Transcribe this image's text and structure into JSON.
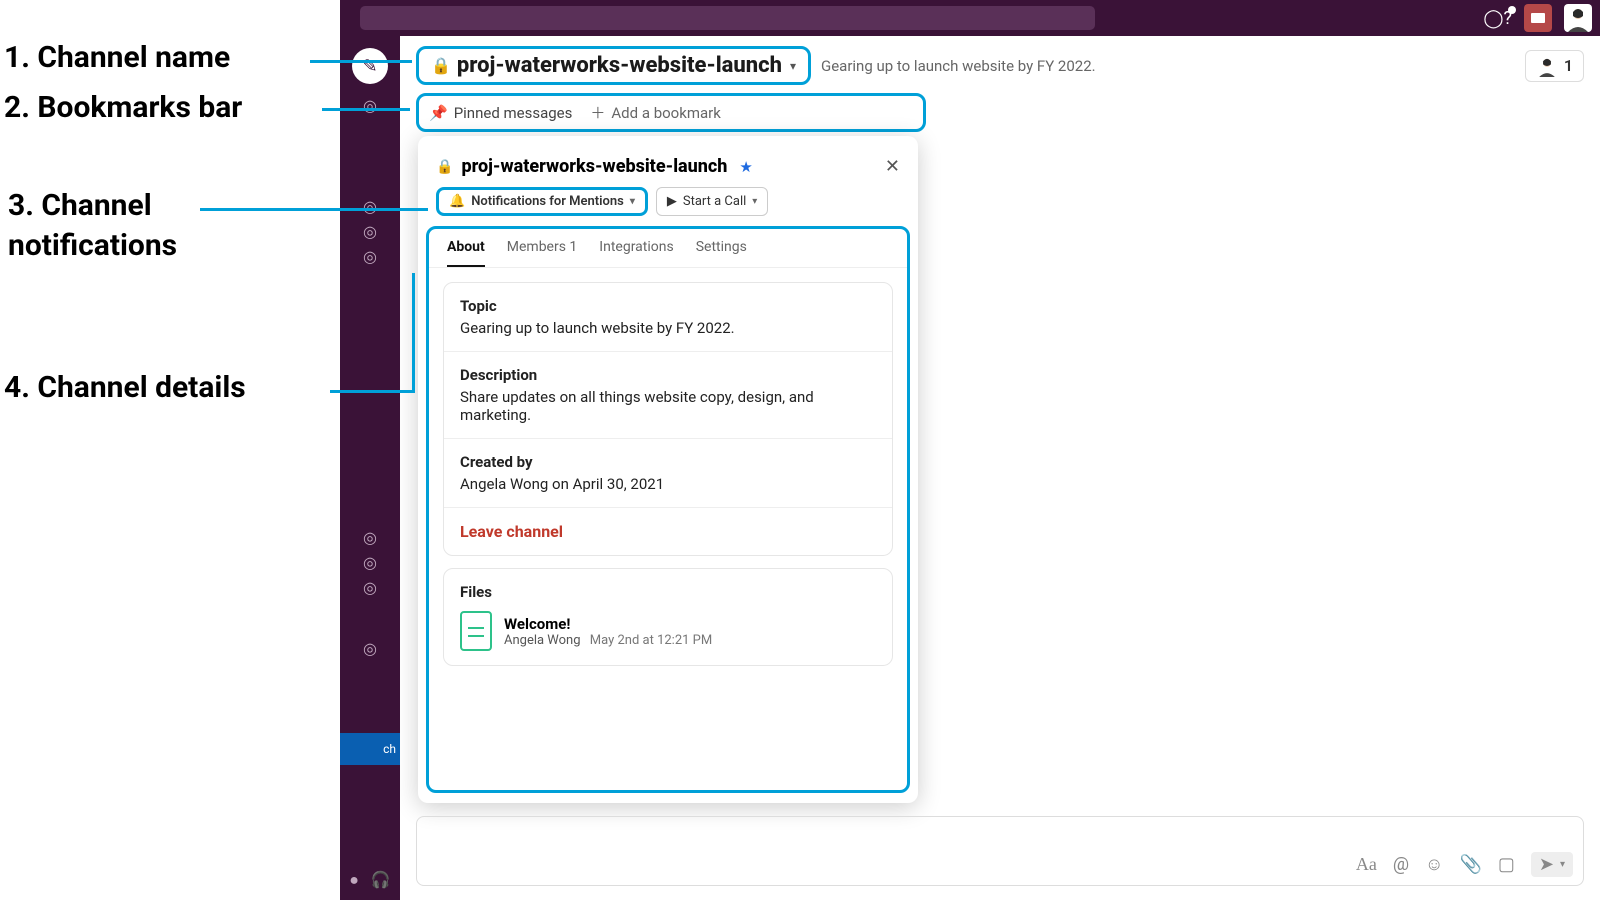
{
  "annotations": {
    "a1": "1. Channel name",
    "a2": "2. Bookmarks bar",
    "a3": "3. Channel notifications",
    "a4": "4. Channel details"
  },
  "header": {
    "channel_name": "proj-waterworks-website-launch",
    "topic": "Gearing up to launch website by FY 2022.",
    "member_count": "1"
  },
  "bookmarks": {
    "pinned": "Pinned messages",
    "add": "Add a bookmark"
  },
  "popover": {
    "title": "proj-waterworks-website-launch",
    "notifications_label": "Notifications for Mentions",
    "start_call_label": "Start a Call",
    "tabs": {
      "about": "About",
      "members": "Members 1",
      "integrations": "Integrations",
      "settings": "Settings"
    },
    "topic_label": "Topic",
    "topic_value": "Gearing up to launch website by FY 2022.",
    "description_label": "Description",
    "description_value": "Share updates on all things website copy, design, and marketing.",
    "created_label": "Created by",
    "created_value": "Angela Wong on April 30, 2021",
    "leave": "Leave channel",
    "files_label": "Files",
    "file": {
      "name": "Welcome!",
      "author": "Angela Wong",
      "time": "May 2nd at 12:21 PM"
    }
  },
  "sidebar": {
    "active_channel_suffix": "ch"
  }
}
